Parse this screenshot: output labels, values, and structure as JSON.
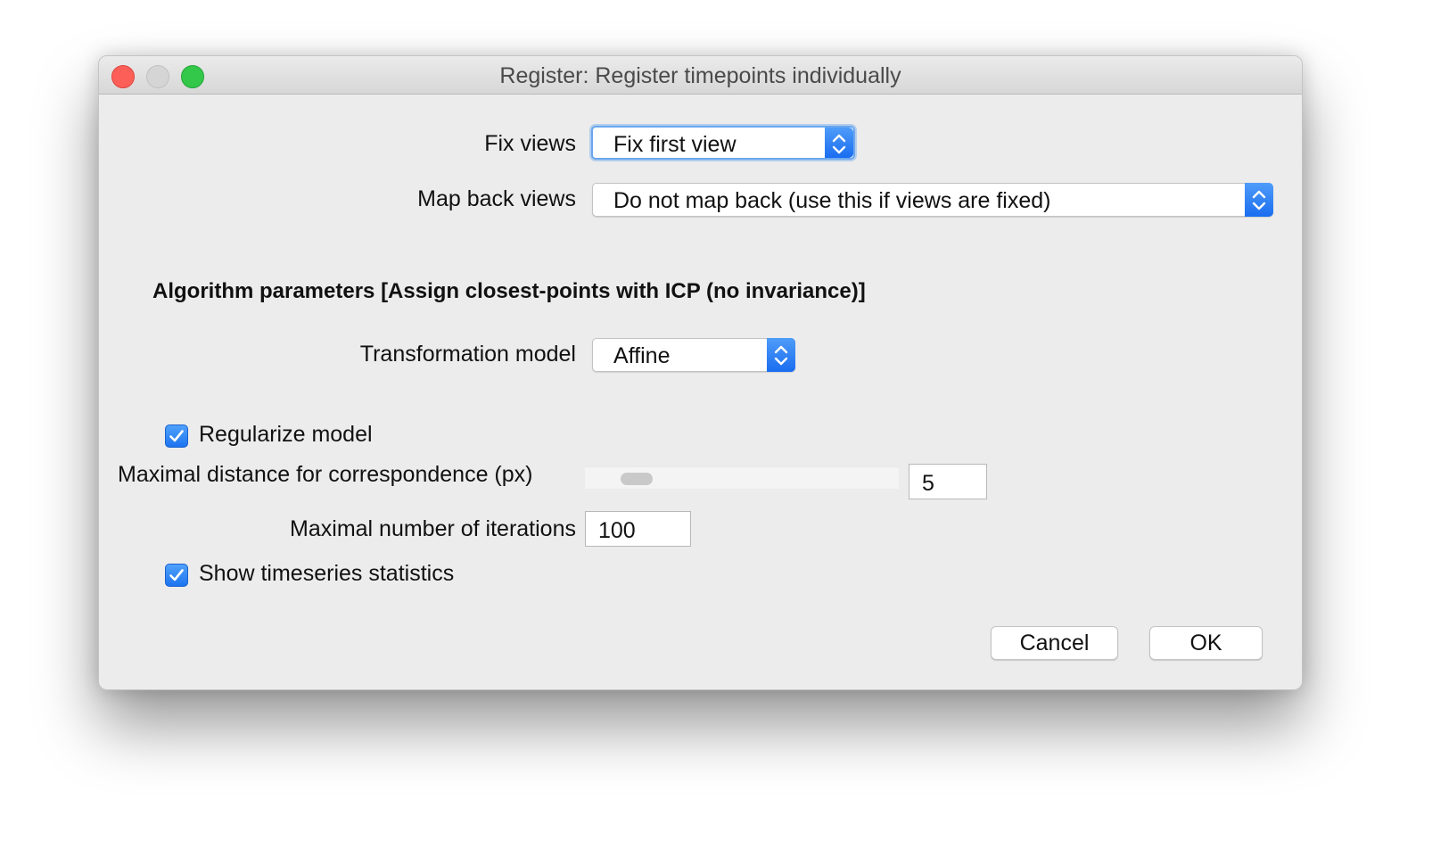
{
  "window": {
    "title": "Register: Register timepoints individually"
  },
  "fix_views": {
    "label": "Fix views",
    "value": "Fix first view"
  },
  "map_back_views": {
    "label": "Map back views",
    "value": "Do not map back (use this if views are fixed)"
  },
  "algorithm": {
    "heading": "Algorithm parameters [Assign closest-points with ICP (no invariance)]",
    "transformation_model": {
      "label": "Transformation model",
      "value": "Affine"
    },
    "regularize_model": {
      "label": "Regularize model",
      "checked": true
    },
    "max_distance": {
      "label": "Maximal distance for correspondence (px)",
      "value": "5"
    },
    "max_iterations": {
      "label": "Maximal number of iterations",
      "value": "100"
    },
    "show_timeseries_statistics": {
      "label": "Show timeseries statistics",
      "checked": true
    }
  },
  "buttons": {
    "cancel": "Cancel",
    "ok": "OK"
  },
  "colors": {
    "accent": "#1d73ef",
    "close": "#fc5f57",
    "maximize": "#34c84a",
    "minimize_disabled": "#d5d5d5"
  }
}
